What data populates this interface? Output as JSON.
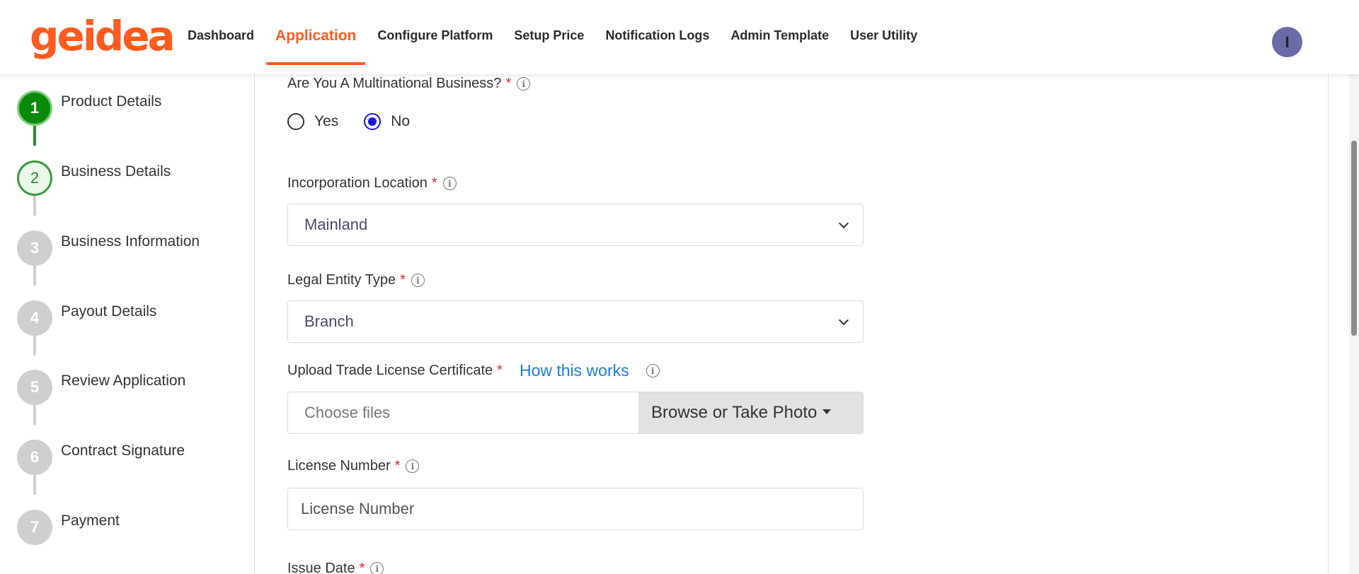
{
  "brand": {
    "logo_text": "geidea",
    "logo_color": "#ff5a1f"
  },
  "nav": {
    "items": [
      {
        "label": "Dashboard"
      },
      {
        "label": "Application",
        "active": true
      },
      {
        "label": "Configure Platform"
      },
      {
        "label": "Setup Price"
      },
      {
        "label": "Notification Logs"
      },
      {
        "label": "Admin Template"
      },
      {
        "label": "User Utility"
      }
    ]
  },
  "user": {
    "avatar_initial": "I",
    "avatar_color": "#6a6aa8"
  },
  "stepper": {
    "steps": [
      {
        "number": "1",
        "label": "Product Details",
        "state": "done"
      },
      {
        "number": "2",
        "label": "Business Details",
        "state": "current"
      },
      {
        "number": "3",
        "label": "Business Information",
        "state": "pending"
      },
      {
        "number": "4",
        "label": "Payout Details",
        "state": "pending"
      },
      {
        "number": "5",
        "label": "Review Application",
        "state": "pending"
      },
      {
        "number": "6",
        "label": "Contract Signature",
        "state": "pending"
      },
      {
        "number": "7",
        "label": "Payment",
        "state": "pending"
      }
    ]
  },
  "form": {
    "multinational": {
      "label": "Are You A Multinational Business?",
      "required_mark": "*",
      "options": [
        {
          "label": "Yes",
          "checked": false
        },
        {
          "label": "No",
          "checked": true
        }
      ]
    },
    "incorporation_location": {
      "label": "Incorporation Location",
      "required_mark": "*",
      "value": "Mainland"
    },
    "legal_entity_type": {
      "label": "Legal Entity Type",
      "required_mark": "*",
      "value": "Branch"
    },
    "trade_license": {
      "label": "Upload Trade License Certificate",
      "required_mark": "*",
      "help_link": "How this works",
      "placeholder": "Choose files",
      "button_label": "Browse or Take Photo"
    },
    "license_number": {
      "label": "License Number",
      "required_mark": "*",
      "placeholder": "License Number"
    },
    "issue_date": {
      "label": "Issue Date",
      "required_mark": "*"
    }
  },
  "colors": {
    "accent": "#ff5a1f",
    "step_done": "#0a8a0a",
    "radio_checked": "#1a1adb",
    "link": "#1a7be0",
    "required": "#e0282e"
  }
}
